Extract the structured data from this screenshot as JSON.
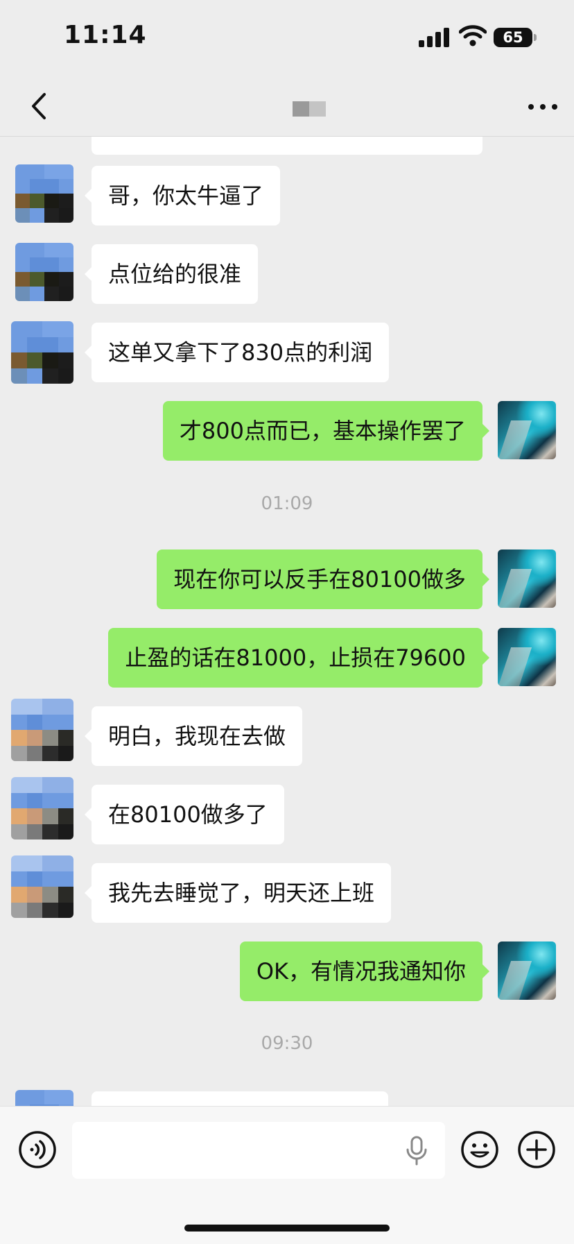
{
  "status": {
    "time": "11:14",
    "battery": "65"
  },
  "nav": {
    "back_icon": "chevron-left-icon",
    "more_icon": "more-horizontal-icon"
  },
  "messages": [
    {
      "side": "in",
      "text": "哥，你太牛逼了"
    },
    {
      "side": "in",
      "text": "点位给的很准"
    },
    {
      "side": "in",
      "text": "这单又拿下了830点的利润"
    },
    {
      "side": "out",
      "text": "才800点而已，基本操作罢了"
    },
    {
      "side": "out",
      "text": "现在你可以反手在80100做多"
    },
    {
      "side": "out",
      "text": "止盈的话在81000，止损在79600"
    },
    {
      "side": "in",
      "text": "明白，我现在去做"
    },
    {
      "side": "in",
      "text": "在80100做多了"
    },
    {
      "side": "in",
      "text": "我先去睡觉了，明天还上班"
    },
    {
      "side": "out",
      "text": "OK，有情况我通知你"
    }
  ],
  "timestamps": [
    "01:09",
    "09:30"
  ],
  "input_bar": {
    "placeholder": ""
  },
  "colors": {
    "incoming_bubble": "#ffffff",
    "outgoing_bubble": "#95ec69",
    "background": "#ededed"
  }
}
